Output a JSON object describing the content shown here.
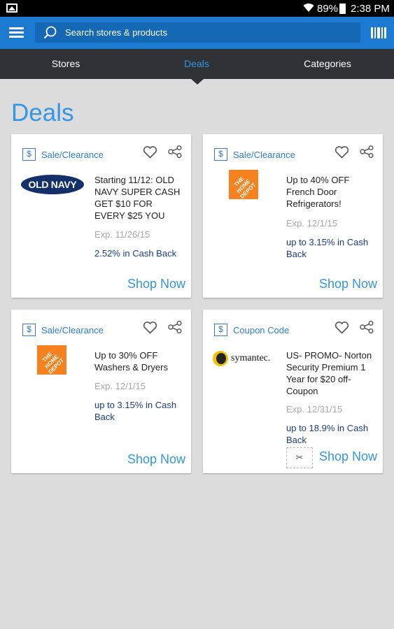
{
  "status_bar": {
    "battery": "89%",
    "time": "2:38 PM"
  },
  "search": {
    "placeholder": "Search stores & products"
  },
  "tabs": [
    {
      "label": "Stores",
      "active": false
    },
    {
      "label": "Deals",
      "active": true
    },
    {
      "label": "Categories",
      "active": false
    }
  ],
  "page_title": "Deals",
  "colors": {
    "accent": "#3596e3",
    "appbar": "#1c7ad0",
    "tabbar": "#2e3135",
    "cashback": "#1b3c7c"
  },
  "deals": [
    {
      "type": "Sale/Clearance",
      "logo": "OLD NAVY",
      "description": "Starting 11/12: OLD NAVY SUPER CASH GET $10 FOR EVERY $25 YOU",
      "expiry": "Exp. 11/26/15",
      "cash_back": "2.52% in Cash Back",
      "cta": "Shop Now"
    },
    {
      "type": "Sale/Clearance",
      "logo": "THE HOME DEPOT",
      "description": "Up to 40% OFF French Door Refrigerators!",
      "expiry": "Exp. 12/1/15",
      "cash_back": "up to 3.15% in Cash Back",
      "cta": "Shop Now"
    },
    {
      "type": "Sale/Clearance",
      "logo": "THE HOME DEPOT",
      "description": "Up to 30% OFF Washers & Dryers",
      "expiry": "Exp. 12/1/15",
      "cash_back": "up to 3.15% in Cash Back",
      "cta": "Shop Now"
    },
    {
      "type": "Coupon Code",
      "logo": "symantec.",
      "description": "US- PROMO- Norton Security Premium 1 Year for $20 off- Coupon",
      "expiry": "Exp. 12/31/15",
      "cash_back": "up to 18.9% in Cash Back",
      "cta": "Shop Now"
    }
  ]
}
